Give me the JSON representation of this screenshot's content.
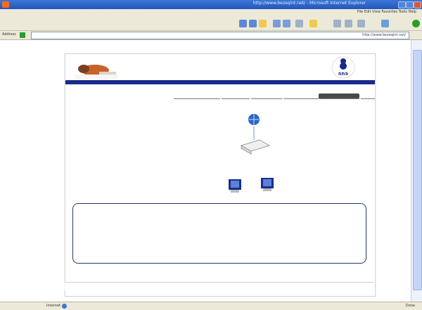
{
  "browser": {
    "window_title": "http://www.bezeqint.net/ - Microsoft Internet Explorer",
    "menu": "File Edit View Favorites Tools Help",
    "address_label": "Address",
    "url": "http://www.bezeqint.net/",
    "status_text": "Internet",
    "zone_text": "Done"
  },
  "page": {
    "header_title": "",
    "logo_text": "פתח",
    "nav_subtitle": "",
    "tabs": [
      {
        "label": "",
        "active": false
      },
      {
        "label": "",
        "active": true
      },
      {
        "label": "",
        "active": false
      },
      {
        "label": "",
        "active": false
      },
      {
        "label": "",
        "active": false
      },
      {
        "label": "",
        "active": false
      }
    ],
    "subtitle": "",
    "captions": {
      "left_mid": "",
      "right_mid": "",
      "computer_left": "",
      "computer_right": ""
    },
    "info_box_text": "",
    "footer_links": ""
  },
  "colors": {
    "title_blue": "#2456b8",
    "nav_blue": "#1a2a8c",
    "box_border": "#1f3b6a"
  }
}
